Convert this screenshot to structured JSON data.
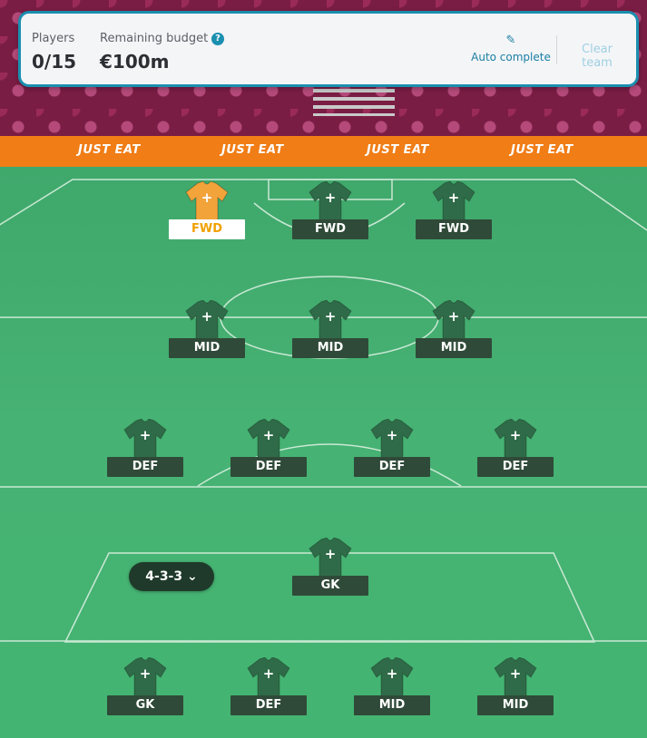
{
  "header": {
    "players_label": "Players",
    "players_value": "0/15",
    "budget_label": "Remaining budget",
    "budget_value": "€100m",
    "help_glyph": "?",
    "auto_complete_label": "Auto complete",
    "clear_team_label": "Clear team",
    "accent_color": "#1a8fb0"
  },
  "banner": {
    "sponsor": "JUST EAT",
    "side_sponsor": "JUST EAT",
    "color": "#f07d16"
  },
  "formation": {
    "selected": "4-3-3",
    "chevron": "⌄"
  },
  "slots": {
    "fwd1": {
      "position": "FWD",
      "selected": true
    },
    "fwd2": {
      "position": "FWD"
    },
    "fwd3": {
      "position": "FWD"
    },
    "mid1": {
      "position": "MID"
    },
    "mid2": {
      "position": "MID"
    },
    "mid3": {
      "position": "MID"
    },
    "def1": {
      "position": "DEF"
    },
    "def2": {
      "position": "DEF"
    },
    "def3": {
      "position": "DEF"
    },
    "def4": {
      "position": "DEF"
    },
    "gk1": {
      "position": "GK"
    },
    "bench1": {
      "position": "GK"
    },
    "bench2": {
      "position": "DEF"
    },
    "bench3": {
      "position": "MID"
    },
    "bench4": {
      "position": "MID"
    }
  },
  "shirt_plus": "+",
  "colors": {
    "shirt_empty": "#2f6b48",
    "shirt_selected": "#f2a33a",
    "label_bg": "#2f4a38"
  }
}
